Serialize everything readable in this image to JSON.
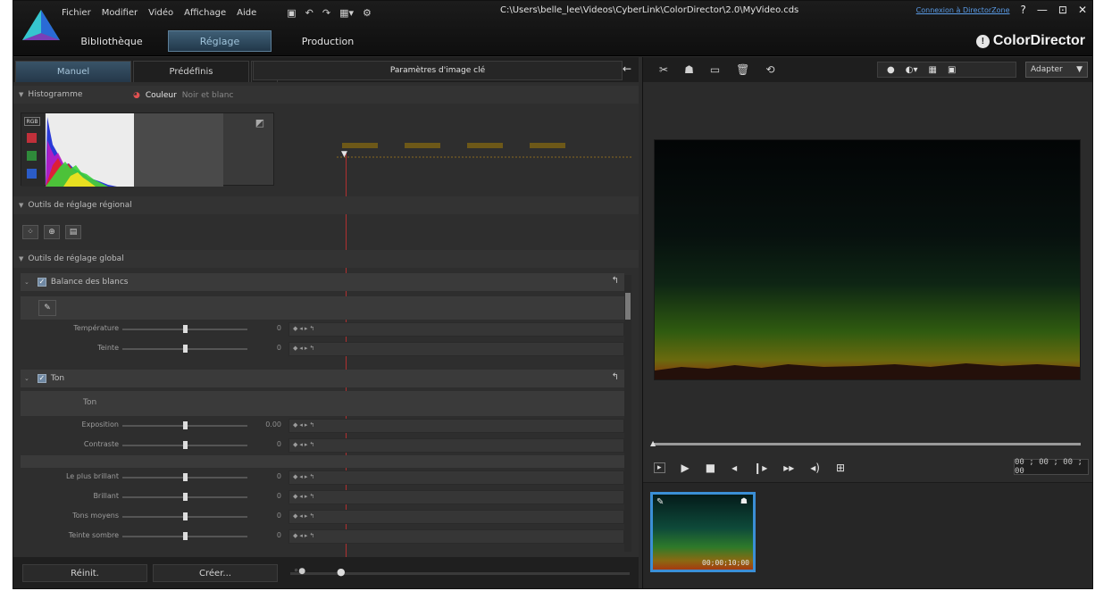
{
  "menubar": {
    "items": [
      "Fichier",
      "Modifier",
      "Vidéo",
      "Affichage",
      "Aide"
    ]
  },
  "window": {
    "title": "C:\\Users\\belle_lee\\Videos\\CyberLink\\ColorDirector\\2.0\\MyVideo.cds",
    "director_zone_link": "Connexion à DirectorZone",
    "help": "?",
    "minimize": "—",
    "restore": "⊡",
    "close": "✕"
  },
  "modes": {
    "library": "Bibliothèque",
    "adjust": "Réglage",
    "production": "Production"
  },
  "brand": {
    "name": "ColorDirector",
    "badge": "!"
  },
  "left_tabs": {
    "manual": "Manuel",
    "presets": "Prédéfinis",
    "keyframe_header": "Paramètres d'image clé"
  },
  "histogram": {
    "title": "Histogramme",
    "opt_color": "Couleur",
    "opt_bw": "Noir et blanc",
    "rgb_label": "RGB"
  },
  "regional": {
    "title": "Outils de réglage régional"
  },
  "global": {
    "title": "Outils de réglage global"
  },
  "white_balance": {
    "title": "Balance des blancs",
    "rows": [
      {
        "label": "Température",
        "value": "0",
        "pos": 0.5
      },
      {
        "label": "Teinte",
        "value": "0",
        "pos": 0.5
      }
    ]
  },
  "tone": {
    "title": "Ton",
    "sub": "Ton",
    "rows_a": [
      {
        "label": "Exposition",
        "value": "0.00",
        "pos": 0.5
      },
      {
        "label": "Contraste",
        "value": "0",
        "pos": 0.5
      }
    ],
    "rows_b": [
      {
        "label": "Le plus brillant",
        "value": "0",
        "pos": 0.5
      },
      {
        "label": "Brillant",
        "value": "0",
        "pos": 0.5
      },
      {
        "label": "Tons moyens",
        "value": "0",
        "pos": 0.5
      },
      {
        "label": "Teinte sombre",
        "value": "0",
        "pos": 0.5
      }
    ]
  },
  "bottom": {
    "reset": "Réinit.",
    "create": "Créer..."
  },
  "right": {
    "fit": "Adapter"
  },
  "player": {
    "timecode": "00 ; 00 ; 00 ; 00",
    "progress": 0
  },
  "thumb": {
    "time": "00;00;10;00"
  },
  "colors": {
    "accent": "#3b8fd6",
    "playhead": "#b03030",
    "tab_active": "#395468"
  }
}
